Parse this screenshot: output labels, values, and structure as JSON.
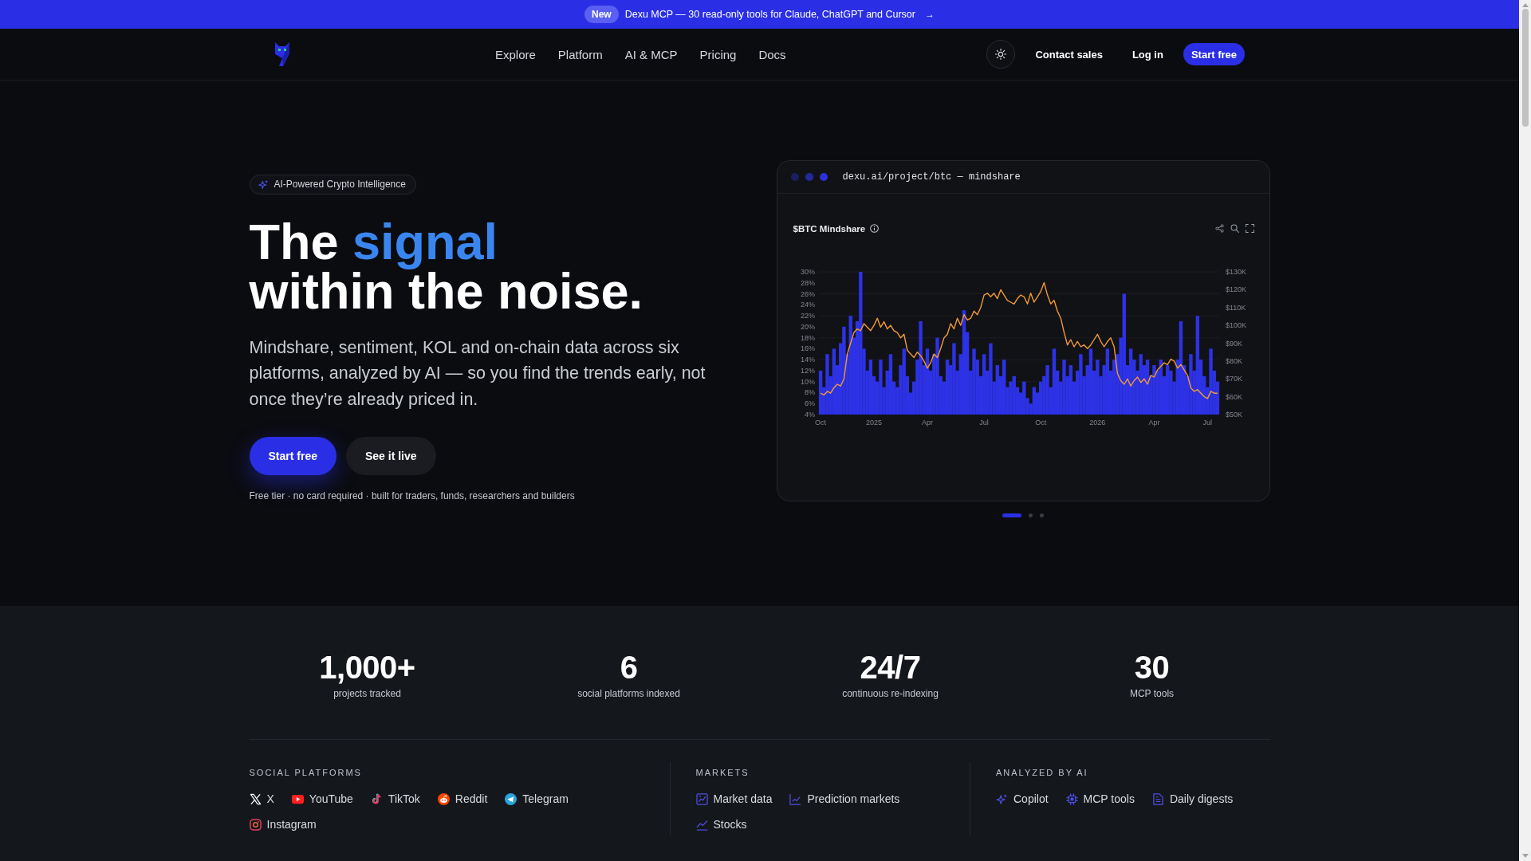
{
  "announcement": {
    "badge": "New",
    "message": "Dexu MCP — 30 read-only tools for Claude, ChatGPT and Cursor",
    "arrow": "→"
  },
  "nav": {
    "links": [
      "Explore",
      "Platform",
      "AI & MCP",
      "Pricing",
      "Docs"
    ],
    "contact": "Contact sales",
    "login": "Log in",
    "cta": "Start free"
  },
  "hero": {
    "badge": "AI-Powered Crypto Intelligence",
    "title": {
      "lead": "The",
      "highlight": "signal",
      "rest": "within the noise."
    },
    "description": "Mindshare, sentiment, KOL and on-chain data across six platforms, analyzed by AI — so you find the trends early, not once they’re already priced in.",
    "buttons": [
      {
        "label": "Start free",
        "kind": "primary"
      },
      {
        "label": "See it live",
        "kind": "secondary"
      }
    ],
    "note": "Free tier · no card required · built for traders, funds, researchers and builders",
    "preview": {
      "address": "dexu.ai/project/btc — mindshare",
      "chart_panel": {
        "title": "$BTC Mindshare",
        "bar_layer": {
          "chart_data": {
            "type": "bar",
            "grid": true,
            "categories": [
              "Oct",
              null,
              null,
              null,
              null,
              null,
              null,
              null,
              null,
              null,
              null,
              null,
              null,
              null,
              null,
              null,
              "2025",
              null,
              null,
              null,
              null,
              null,
              null,
              null,
              null,
              null,
              null,
              null,
              null,
              null,
              null,
              null,
              "Apr",
              null,
              null,
              null,
              null,
              null,
              null,
              null,
              null,
              null,
              null,
              null,
              null,
              null,
              null,
              null,
              null,
              "Jul",
              null,
              null,
              null,
              null,
              null,
              null,
              null,
              null,
              null,
              null,
              null,
              null,
              null,
              null,
              null,
              null,
              "Oct",
              null,
              null,
              null,
              null,
              null,
              null,
              null,
              null,
              null,
              null,
              null,
              null,
              null,
              null,
              null,
              null,
              "2026",
              null,
              null,
              null,
              null,
              null,
              null,
              null,
              null,
              null,
              null,
              null,
              null,
              null,
              null,
              null,
              null,
              "Apr",
              null,
              null,
              null,
              null,
              null,
              null,
              null,
              null,
              null,
              null,
              null,
              null,
              null,
              null,
              null,
              "Jul",
              null,
              null,
              null
            ],
            "ylim": [
              4,
              30
            ],
            "yticks": [
              {
                "value": 4,
                "label": "4%"
              },
              {
                "value": 6,
                "label": "6%"
              },
              {
                "value": 8,
                "label": "8%"
              },
              {
                "value": 10,
                "label": "10%"
              },
              {
                "value": 12,
                "label": "12%"
              },
              {
                "value": 14,
                "label": "14%"
              },
              {
                "value": 16,
                "label": "16%"
              },
              {
                "value": 18,
                "label": "18%"
              },
              {
                "value": 20,
                "label": "20%"
              },
              {
                "value": 22,
                "label": "22%"
              },
              {
                "value": 24,
                "label": "24%"
              },
              {
                "value": 26,
                "label": "26%"
              },
              {
                "value": 28,
                "label": "28%"
              },
              {
                "value": 30,
                "label": "30%"
              }
            ],
            "series": [
              {
                "color": "#2d32e6",
                "values": [
                  12,
                  9,
                  15,
                  11,
                  16,
                  13,
                  17,
                  20,
                  15,
                  22,
                  18,
                  21,
                  30,
                  16,
                  12,
                  14,
                  11,
                  10,
                  14,
                  9,
                  12,
                  15,
                  10,
                  9,
                  13,
                  16,
                  11,
                  8,
                  10,
                  14,
                  21,
                  13,
                  16,
                  12,
                  15,
                  18,
                  11,
                  10,
                  14,
                  13,
                  17,
                  12,
                  15,
                  23,
                  19,
                  12,
                  16,
                  14,
                  11,
                  15,
                  12,
                  17,
                  10,
                  13,
                  11,
                  14,
                  9,
                  10,
                  11,
                  9,
                  8,
                  10,
                  7,
                  6,
                  9,
                  8,
                  10,
                  11,
                  13,
                  9,
                  16,
                  12,
                  10,
                  14,
                  11,
                  13,
                  10,
                  12,
                  15,
                  11,
                  13,
                  16,
                  12,
                  14,
                  11,
                  13,
                  16,
                  12,
                  14,
                  15,
                  18,
                  26,
                  13,
                  16,
                  14,
                  12,
                  15,
                  13,
                  14,
                  11,
                  13,
                  12,
                  14,
                  11,
                  13,
                  12,
                  10,
                  14,
                  21,
                  13,
                  11,
                  15,
                  12,
                  22,
                  14,
                  11,
                  9,
                  16,
                  12,
                  10
                ]
              }
            ]
          }
        },
        "line_layer": {
          "chart_data": {
            "type": "line",
            "categories": [
              null,
              null,
              null,
              null,
              null,
              null,
              null,
              null,
              null,
              null,
              null,
              null,
              null,
              null,
              null,
              null,
              null,
              null,
              null,
              null,
              null,
              null,
              null,
              null,
              null,
              null,
              null,
              null,
              null,
              null,
              null,
              null,
              null,
              null,
              null,
              null,
              null,
              null,
              null,
              null,
              null,
              null,
              null,
              null,
              null,
              null,
              null,
              null,
              null,
              null,
              null,
              null,
              null,
              null,
              null,
              null,
              null,
              null,
              null,
              null,
              null,
              null,
              null,
              null,
              null,
              null,
              null,
              null,
              null,
              null,
              null,
              null,
              null,
              null,
              null,
              null,
              null,
              null,
              null,
              null,
              null,
              null,
              null,
              null,
              null,
              null,
              null,
              null,
              null,
              null,
              null,
              null,
              null,
              null,
              null,
              null,
              null,
              null,
              null,
              null,
              null,
              null,
              null,
              null,
              null,
              null,
              null,
              null,
              null,
              null,
              null,
              null,
              null,
              null,
              null,
              null,
              null,
              null,
              null,
              null
            ],
            "ylim": [
              50,
              130
            ],
            "yticks": [
              {
                "value": 50,
                "label": "$50K"
              },
              {
                "value": 60,
                "label": "$60K"
              },
              {
                "value": 70,
                "label": "$70K"
              },
              {
                "value": 80,
                "label": "$80K"
              },
              {
                "value": 90,
                "label": "$90K"
              },
              {
                "value": 100,
                "label": "$100K"
              },
              {
                "value": 110,
                "label": "$110K"
              },
              {
                "value": 120,
                "label": "$120K"
              },
              {
                "value": 130,
                "label": "$130K"
              }
            ],
            "series": [
              {
                "color": "#f39a35",
                "values": [
                  62,
                  61,
                  63,
                  62,
                  65,
                  67,
                  66,
                  70,
                  84,
                  90,
                  96,
                  98,
                  97,
                  101,
                  99,
                  97,
                  100,
                  104,
                  99,
                  102,
                  98,
                  100,
                  97,
                  96,
                  93,
                  95,
                  86,
                  84,
                  82,
                  85,
                  83,
                  80,
                  76,
                  79,
                  84,
                  82,
                  87,
                  93,
                  95,
                  101,
                  98,
                  104,
                  100,
                  106,
                  103,
                  104,
                  108,
                  106,
                  110,
                  117,
                  118,
                  116,
                  118,
                  115,
                  120,
                  117,
                  114,
                  113,
                  112,
                  115,
                  117,
                  116,
                  112,
                  118,
                  113,
                  116,
                  119,
                  124,
                  117,
                  112,
                  114,
                  108,
                  104,
                  96,
                  89,
                  92,
                  88,
                  91,
                  88,
                  89,
                  87,
                  89,
                  92,
                  95,
                  91,
                  88,
                  91,
                  93,
                  88,
                  73,
                  69,
                  67,
                  70,
                  66,
                  69,
                  71,
                  68,
                  70,
                  67,
                  72,
                  71,
                  75,
                  77,
                  79,
                  78,
                  81,
                  80,
                  76,
                  78,
                  75,
                  72,
                  65,
                  63,
                  64,
                  62,
                  60,
                  59,
                  63,
                  62,
                  62
                ]
              }
            ]
          }
        }
      },
      "carousel": [
        {
          "selected": true
        },
        {
          "selected": false
        },
        {
          "selected": false
        }
      ]
    }
  },
  "stats": [
    {
      "value": "1,000+",
      "label": "projects tracked"
    },
    {
      "value": "6",
      "label": "social platforms indexed"
    },
    {
      "value": "24/7",
      "label": "continuous re-indexing"
    },
    {
      "value": "30",
      "label": "MCP tools"
    }
  ],
  "categories": [
    {
      "heading": "SOCIAL PLATFORMS",
      "items": [
        "X",
        "YouTube",
        "TikTok",
        "Reddit",
        "Telegram",
        "Instagram"
      ]
    },
    {
      "heading": "MARKETS",
      "items": [
        "Market data",
        "Prediction markets",
        "Stocks"
      ]
    },
    {
      "heading": "ANALYZED BY AI",
      "items": [
        "Copilot",
        "MCP tools",
        "Daily digests"
      ]
    }
  ]
}
